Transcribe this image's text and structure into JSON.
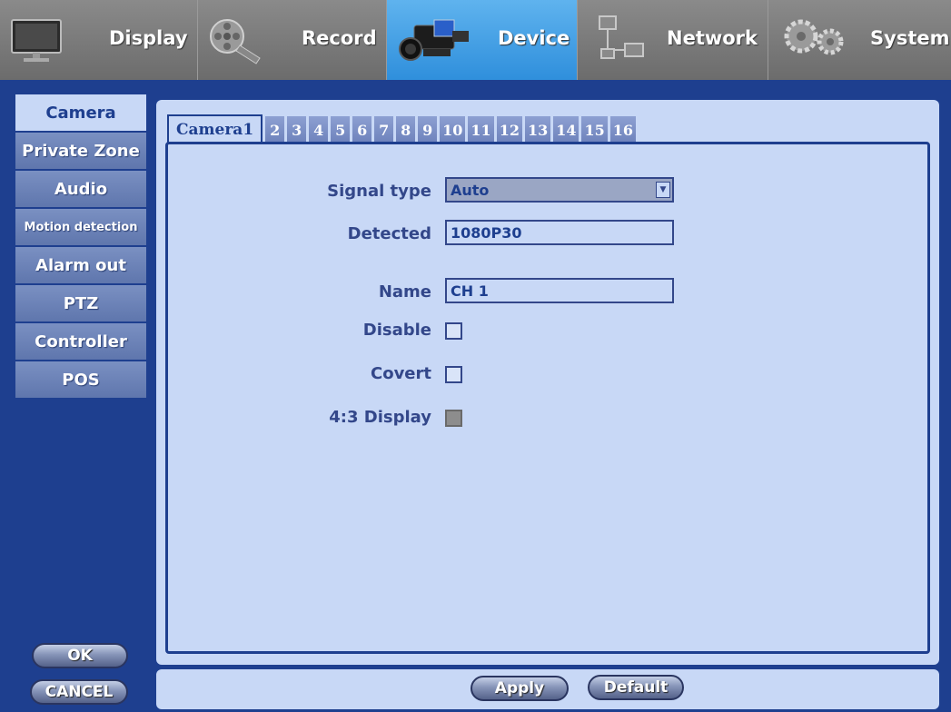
{
  "menu": {
    "items": [
      {
        "label": "Display",
        "icon": "monitor-icon",
        "active": false
      },
      {
        "label": "Record",
        "icon": "film-reel-icon",
        "active": false
      },
      {
        "label": "Device",
        "icon": "camcorder-icon",
        "active": true
      },
      {
        "label": "Network",
        "icon": "network-icon",
        "active": false
      },
      {
        "label": "System",
        "icon": "gears-icon",
        "active": false
      }
    ]
  },
  "sidebar": {
    "items": [
      {
        "label": "Camera",
        "active": true
      },
      {
        "label": "Private Zone"
      },
      {
        "label": "Audio"
      },
      {
        "label": "Motion detection"
      },
      {
        "label": "Alarm out"
      },
      {
        "label": "PTZ"
      },
      {
        "label": "Controller"
      },
      {
        "label": "POS"
      }
    ],
    "ok_label": "OK",
    "cancel_label": "CANCEL"
  },
  "tabs": [
    "Camera1",
    "2",
    "3",
    "4",
    "5",
    "6",
    "7",
    "8",
    "9",
    "10",
    "11",
    "12",
    "13",
    "14",
    "15",
    "16"
  ],
  "form": {
    "signal_type_label": "Signal type",
    "signal_type_value": "Auto",
    "detected_label": "Detected",
    "detected_value": "1080P30",
    "name_label": "Name",
    "name_value": "CH 1",
    "disable_label": "Disable",
    "disable_checked": false,
    "covert_label": "Covert",
    "covert_checked": false,
    "display43_label": "4:3 Display",
    "display43_checked": true
  },
  "actions": {
    "apply_label": "Apply",
    "default_label": "Default"
  },
  "colors": {
    "background": "#1e3f8f",
    "panel": "#c8d8f6",
    "active_menu": "#3a9be4",
    "text_label": "#33478a"
  }
}
